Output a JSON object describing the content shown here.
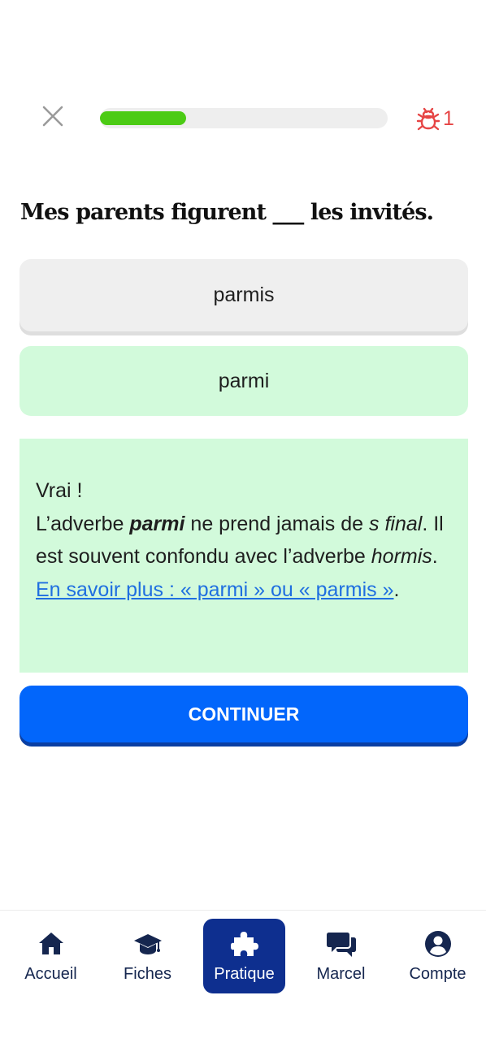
{
  "header": {
    "close_icon": "close-icon",
    "progress_percent": 30,
    "progress_color": "#4ccb15",
    "bug_icon": "bug-icon",
    "bug_count": "1"
  },
  "question": {
    "text": "Mes parents figurent ___ les invités."
  },
  "options": [
    {
      "label": "parmis",
      "state": "neutral"
    },
    {
      "label": "parmi",
      "state": "correct"
    }
  ],
  "feedback": {
    "verdict": "Vrai !",
    "t1": "L’adverbe ",
    "em1": "parmi",
    "t2": " ne prend jamais de ",
    "em2": "s final",
    "t3": ". Il est souvent confondu avec l’adverbe ",
    "em3": "hormis",
    "t4": ". ",
    "link": "En savoir plus : « parmi » ou « parmis »",
    "t5": "."
  },
  "continue_label": "CONTINUER",
  "colors": {
    "accent": "#0266fb",
    "nav_active": "#0e2f8f",
    "correct_bg": "#d2fadb",
    "bug": "#e64545"
  },
  "nav": [
    {
      "label": "Accueil",
      "icon": "home-icon",
      "active": false
    },
    {
      "label": "Fiches",
      "icon": "graduation-cap-icon",
      "active": false
    },
    {
      "label": "Pratique",
      "icon": "puzzle-icon",
      "active": true
    },
    {
      "label": "Marcel",
      "icon": "chat-bubbles-icon",
      "active": false
    },
    {
      "label": "Compte",
      "icon": "user-circle-icon",
      "active": false
    }
  ]
}
